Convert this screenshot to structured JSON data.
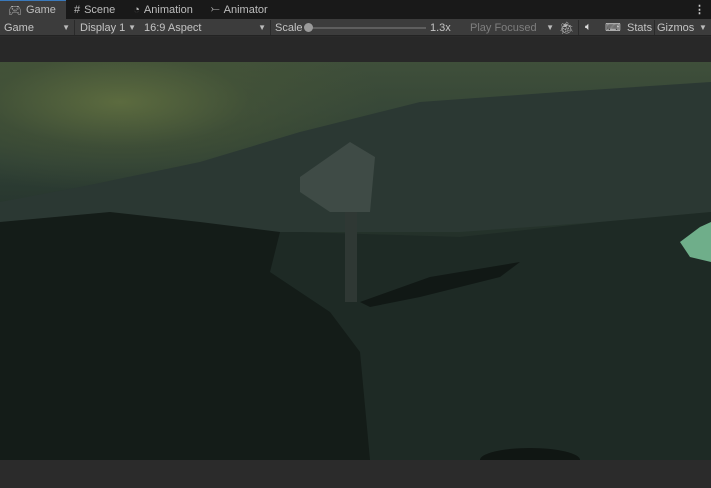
{
  "tabs": [
    {
      "label": "Game",
      "icon": "gamepad-icon",
      "active": true
    },
    {
      "label": "Scene",
      "icon": "grid-icon"
    },
    {
      "label": "Animation",
      "icon": "clock-icon"
    },
    {
      "label": "Animator",
      "icon": "animator-icon"
    }
  ],
  "toolbar": {
    "view_mode": "Game",
    "display": "Display 1",
    "aspect": "16:9 Aspect",
    "scale_label": "Scale",
    "scale_value": "1.3x",
    "play_mode": "Play Focused",
    "stats": "Stats",
    "gizmos": "Gizmos"
  },
  "accent": "#3a79bb"
}
